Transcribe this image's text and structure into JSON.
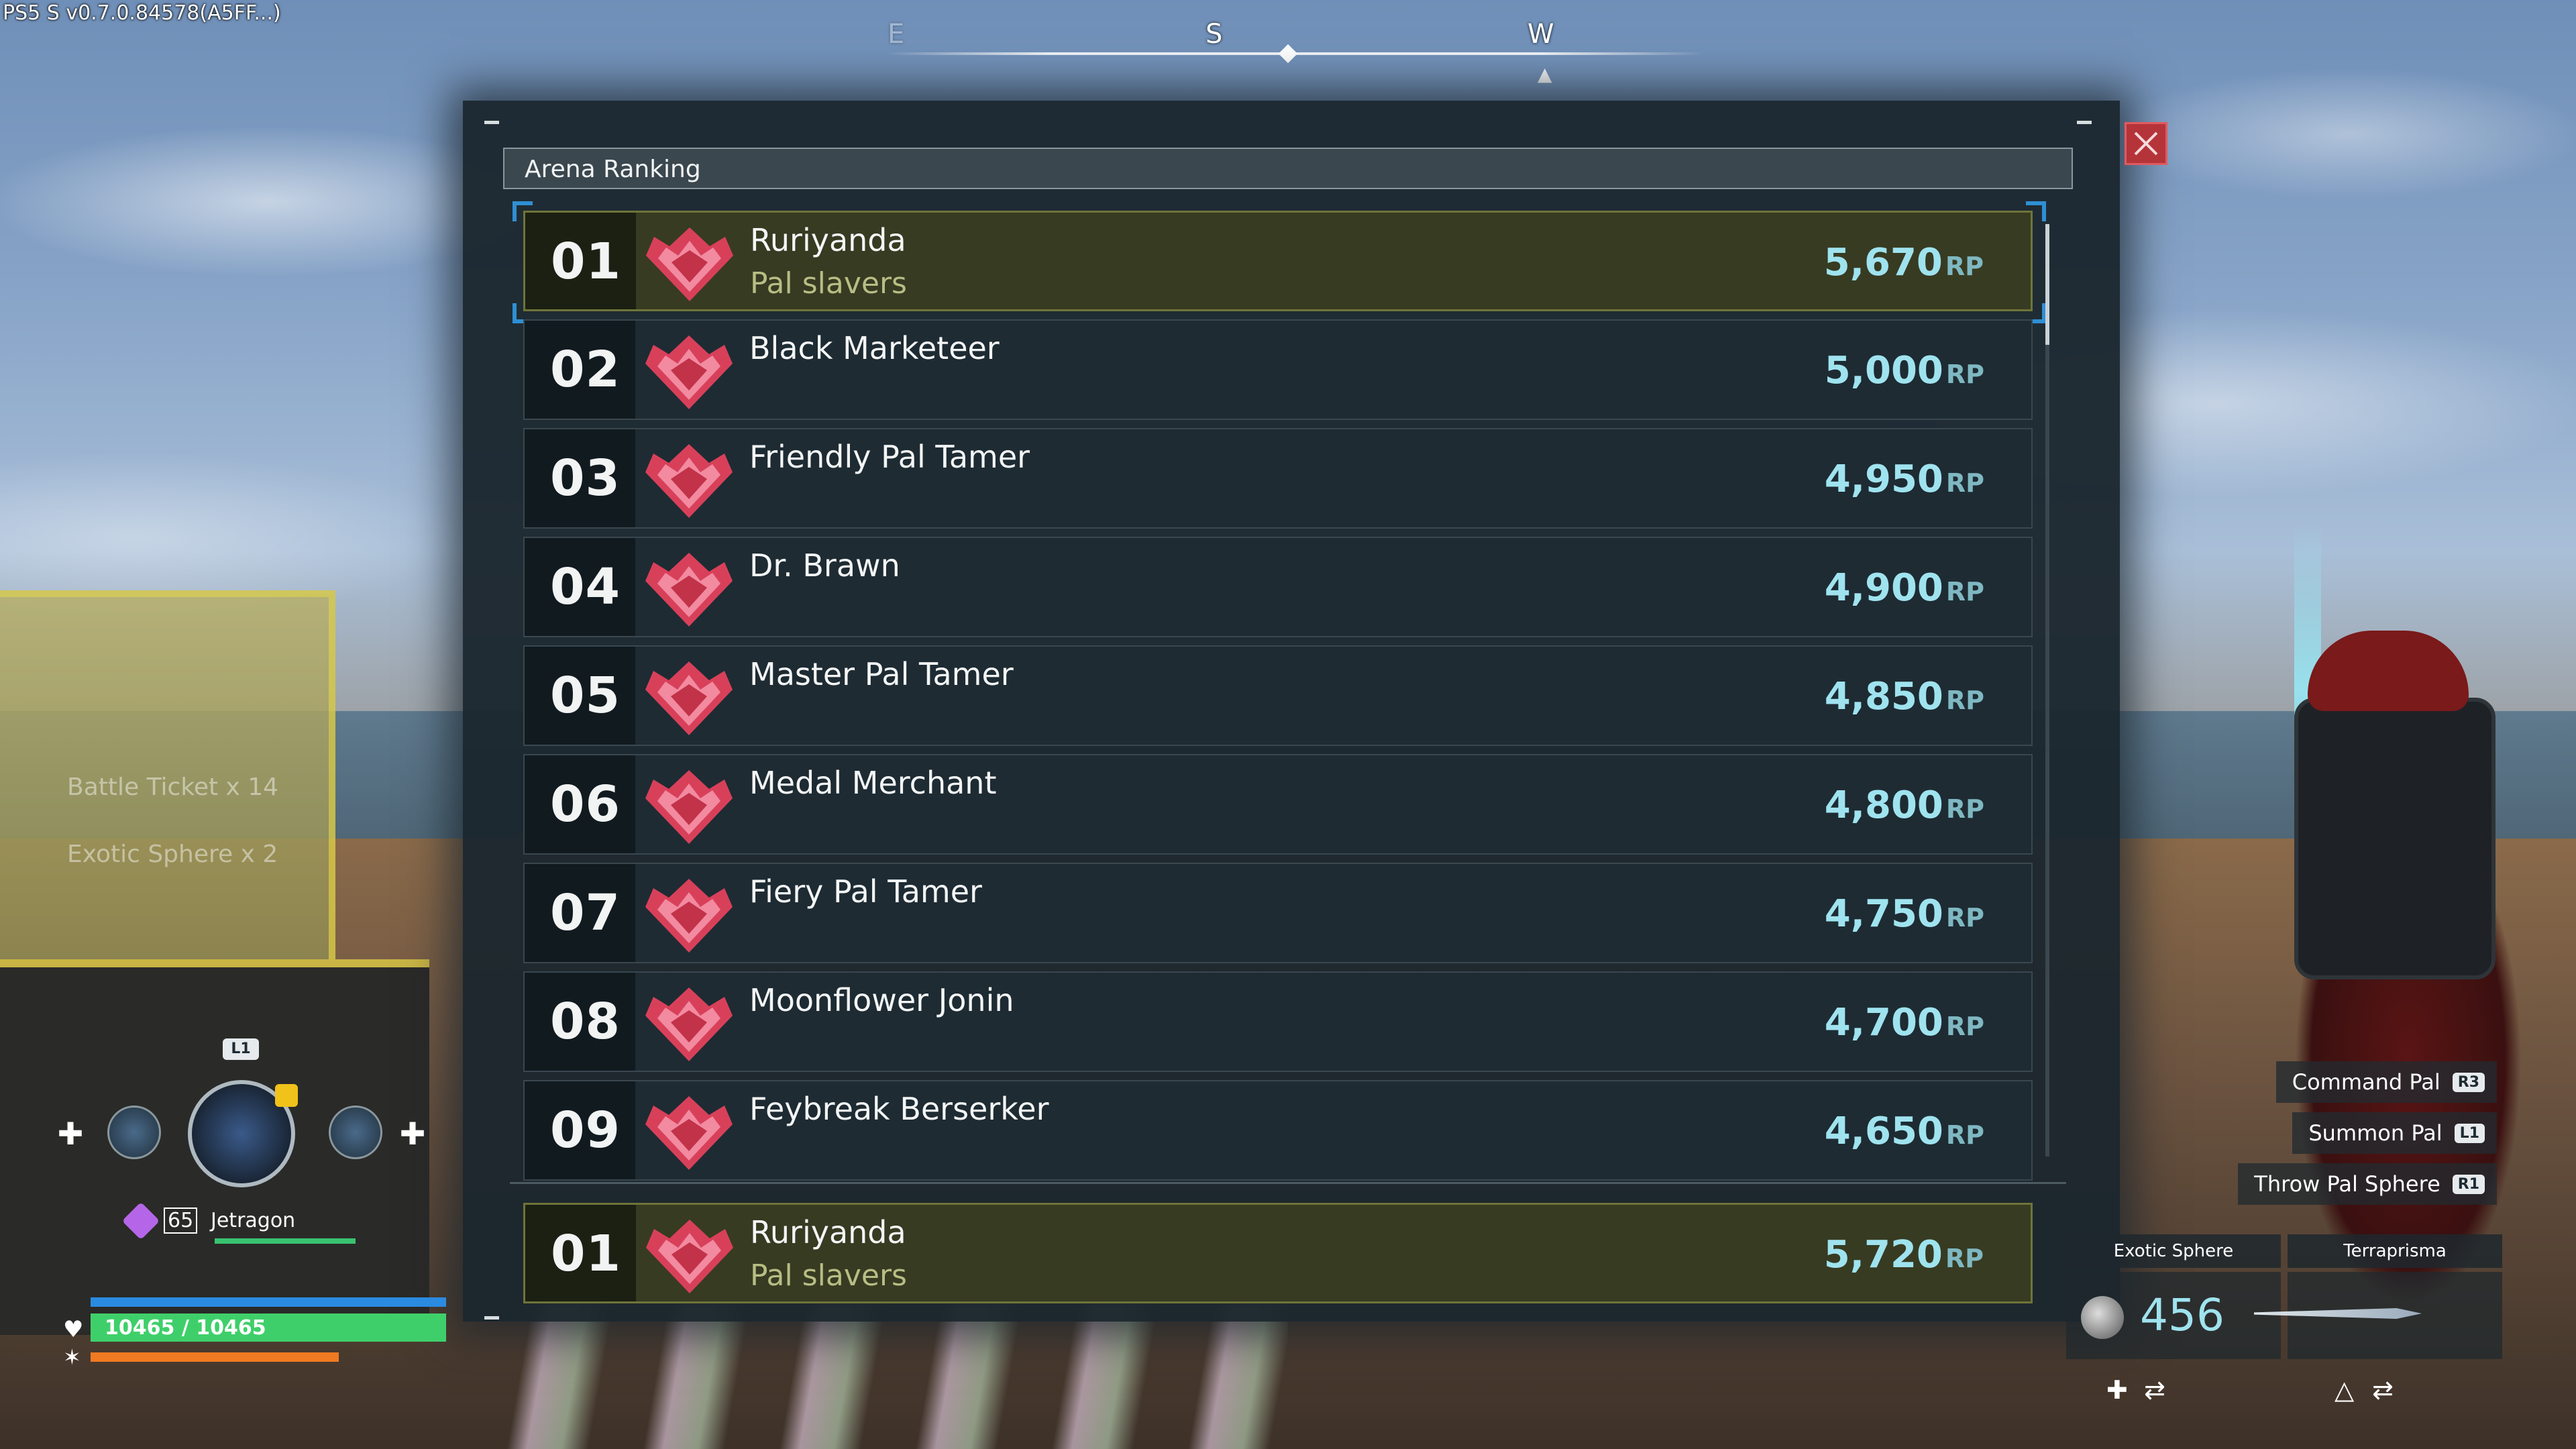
{
  "version": "PS5 S v0.7.0.84578(A5FF...)",
  "compass": {
    "letters": [
      "E",
      "S",
      "W"
    ]
  },
  "panel": {
    "title": "Arena Ranking",
    "close_icon": "close-icon"
  },
  "ranking": [
    {
      "rank": "01",
      "name": "Ruriyanda",
      "guild": "Pal slavers",
      "points": "5,670",
      "unit": "RP",
      "highlight": true
    },
    {
      "rank": "02",
      "name": "Black Marketeer",
      "guild": "",
      "points": "5,000",
      "unit": "RP",
      "highlight": false
    },
    {
      "rank": "03",
      "name": "Friendly Pal Tamer",
      "guild": "",
      "points": "4,950",
      "unit": "RP",
      "highlight": false
    },
    {
      "rank": "04",
      "name": "Dr. Brawn",
      "guild": "",
      "points": "4,900",
      "unit": "RP",
      "highlight": false
    },
    {
      "rank": "05",
      "name": "Master Pal Tamer",
      "guild": "",
      "points": "4,850",
      "unit": "RP",
      "highlight": false
    },
    {
      "rank": "06",
      "name": "Medal Merchant",
      "guild": "",
      "points": "4,800",
      "unit": "RP",
      "highlight": false
    },
    {
      "rank": "07",
      "name": "Fiery Pal Tamer",
      "guild": "",
      "points": "4,750",
      "unit": "RP",
      "highlight": false
    },
    {
      "rank": "08",
      "name": "Moonflower Jonin",
      "guild": "",
      "points": "4,700",
      "unit": "RP",
      "highlight": false
    },
    {
      "rank": "09",
      "name": "Feybreak Berserker",
      "guild": "",
      "points": "4,650",
      "unit": "RP",
      "highlight": false
    }
  ],
  "own_rank": {
    "rank": "01",
    "name": "Ruriyanda",
    "guild": "Pal slavers",
    "points": "5,720",
    "unit": "RP"
  },
  "rewards_faded": [
    "Battle Ticket x 14",
    "Exotic Sphere x 2"
  ],
  "hud_left": {
    "l1": "L1",
    "pal_level": "65",
    "pal_name": "Jetragon",
    "hp": "10465 / 10465"
  },
  "commands": [
    {
      "label": "Command Pal",
      "button": "R3"
    },
    {
      "label": "Summon Pal",
      "button": "L1"
    },
    {
      "label": "Throw Pal Sphere",
      "button": "R1"
    }
  ],
  "weapons": {
    "sphere_label": "Exotic Sphere",
    "sphere_count": "456",
    "weapon_label": "Terraprisma"
  },
  "colors": {
    "panel_bg": "#1b262e",
    "highlight_row": "#373b22",
    "points": "#9fe3ef",
    "guild": "#b8bd84",
    "close": "#b5343a"
  }
}
